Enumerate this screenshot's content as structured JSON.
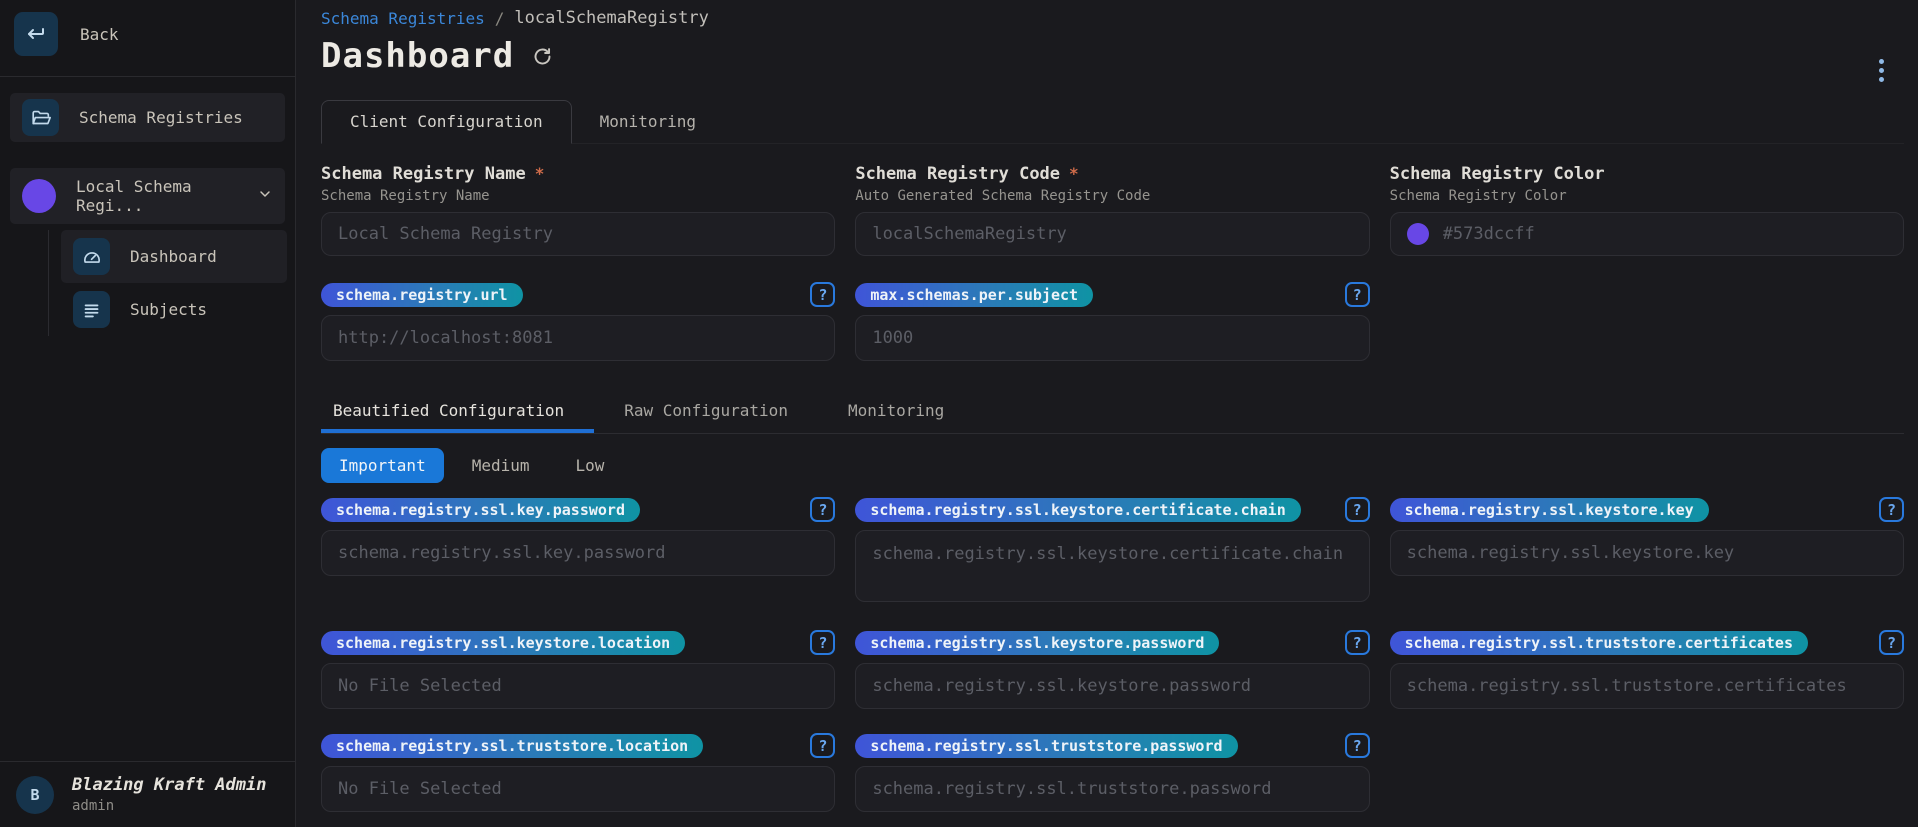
{
  "colors": {
    "accent_blue": "#1a78d8",
    "breadcrumb_link_blue": "#3b87d9",
    "badge_gradient_start": "#3f55d8",
    "badge_gradient_end": "#0f93a4",
    "registry_purple": "#6847e6",
    "help_icon_blue": "#2979dd",
    "required_asterisk": "#d06c4a"
  },
  "sidebar": {
    "back_label": "Back",
    "registries_label": "Schema Registries",
    "registry_name": "Local Schema Regi...",
    "nav": [
      {
        "label": "Dashboard"
      },
      {
        "label": "Subjects"
      }
    ],
    "user": {
      "initial": "B",
      "name": "Blazing Kraft Admin",
      "role": "admin"
    }
  },
  "header": {
    "breadcrumb_link": "Schema Registries",
    "breadcrumb_separator": "/",
    "breadcrumb_current": "localSchemaRegistry",
    "title": "Dashboard"
  },
  "tabs": [
    {
      "label": "Client Configuration"
    },
    {
      "label": "Monitoring"
    }
  ],
  "form": {
    "name": {
      "label": "Schema Registry Name",
      "required_marker": "*",
      "helper": "Schema Registry Name",
      "placeholder": "Local Schema Registry"
    },
    "code": {
      "label": "Schema Registry Code",
      "required_marker": "*",
      "helper": "Auto Generated Schema Registry Code",
      "placeholder": "localSchemaRegistry"
    },
    "color": {
      "label": "Schema Registry Color",
      "helper": "Schema Registry Color",
      "value": "#573dccff"
    }
  },
  "common_config": [
    {
      "key": "schema.registry.url",
      "placeholder": "http://localhost:8081",
      "help": "?"
    },
    {
      "key": "max.schemas.per.subject",
      "placeholder": "1000",
      "help": "?"
    }
  ],
  "config_tabs": [
    {
      "label": "Beautified Configuration"
    },
    {
      "label": "Raw Configuration"
    },
    {
      "label": "Monitoring"
    }
  ],
  "importance": [
    {
      "label": "Important"
    },
    {
      "label": "Medium"
    },
    {
      "label": "Low"
    }
  ],
  "ssl_config": [
    {
      "key": "schema.registry.ssl.key.password",
      "placeholder": "schema.registry.ssl.key.password",
      "help": "?"
    },
    {
      "key": "schema.registry.ssl.keystore.certificate.chain",
      "placeholder": "schema.registry.ssl.keystore.certificate.chain",
      "help": "?"
    },
    {
      "key": "schema.registry.ssl.keystore.key",
      "placeholder": "schema.registry.ssl.keystore.key",
      "help": "?"
    },
    {
      "key": "schema.registry.ssl.keystore.location",
      "placeholder": "No File Selected",
      "help": "?"
    },
    {
      "key": "schema.registry.ssl.keystore.password",
      "placeholder": "schema.registry.ssl.keystore.password",
      "help": "?"
    },
    {
      "key": "schema.registry.ssl.truststore.certificates",
      "placeholder": "schema.registry.ssl.truststore.certificates",
      "help": "?"
    },
    {
      "key": "schema.registry.ssl.truststore.location",
      "placeholder": "No File Selected",
      "help": "?"
    },
    {
      "key": "schema.registry.ssl.truststore.password",
      "placeholder": "schema.registry.ssl.truststore.password",
      "help": "?"
    }
  ]
}
